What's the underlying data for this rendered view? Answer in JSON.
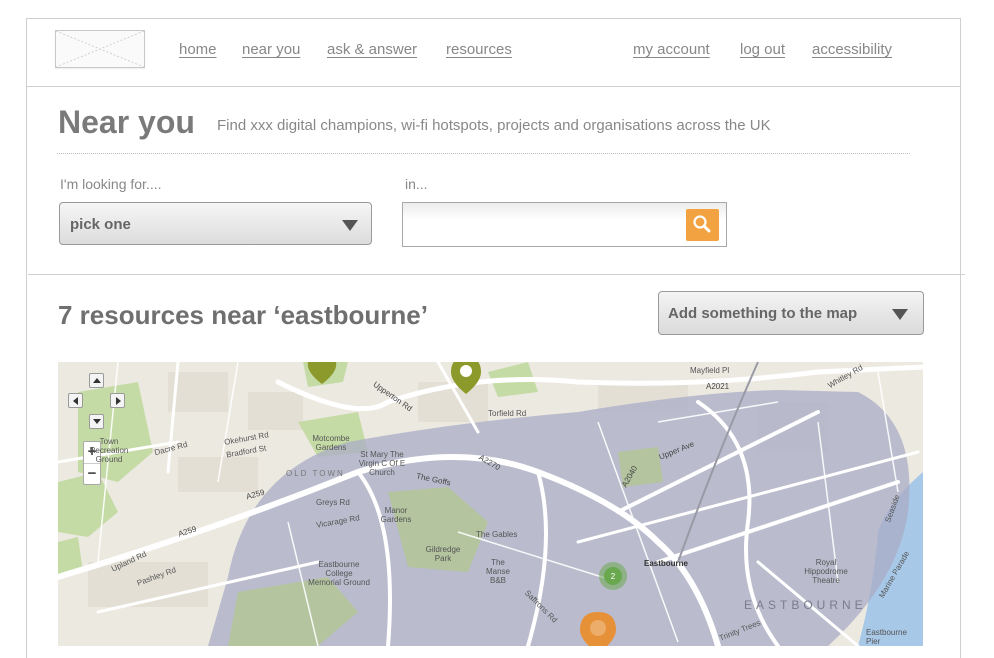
{
  "nav": {
    "left": [
      "home",
      "near you",
      "ask & answer",
      "resources"
    ],
    "right": [
      "my account",
      "log out",
      "accessibility"
    ]
  },
  "page": {
    "title": "Near you",
    "subtitle": "Find xxx digital champions, wi-fi hotspots, projects and organisations across the UK"
  },
  "filter": {
    "looking_label": "I'm looking for....",
    "select_value": "pick one",
    "in_label": "in...",
    "search_value": "",
    "search_placeholder": ""
  },
  "results": {
    "heading": "7 resources near ‘eastbourne’",
    "add_button": "Add something to the map"
  },
  "map": {
    "area_color": "#a9acc6",
    "marker_colors": {
      "olive": "#8c9a2b",
      "green": "#6aa84f",
      "orange": "#e69138"
    },
    "cluster_count": "2",
    "labels": {
      "eastbourne_big": "EASTBOURNE",
      "old_town": "OLD TOWN",
      "motcombe": "Motcombe Gardens",
      "manor": "Manor Gardens",
      "gildredge": "Gildredge Park",
      "station": "Eastbourne",
      "college": "Eastbourne College Memorial Ground",
      "royal": "Royal Hippodrome Theatre",
      "pier": "Eastbourne Pier",
      "the_gables": "The Gables",
      "the_manse": "The Manse B&B",
      "st_mary": "St Mary The Virgin C Of E Church",
      "the_goffs": "The Goffs",
      "upper_ave": "Upper Ave",
      "upperton_rd": "Upperton Rd",
      "a2021": "A2021",
      "a259a": "A259",
      "a259b": "A259",
      "a2270": "A2270",
      "a2040": "A2040",
      "mayfield": "Mayfield Pl",
      "torfield": "Torfield Rd",
      "pashley": "Pashley Rd",
      "upland": "Upland Rd",
      "greys": "Greys Rd",
      "vicarage": "Vicarage Rd",
      "saffrons": "Saffrons Rd",
      "whitley": "Whitley Rd",
      "seaside": "Seaside",
      "marine": "Marine Parade",
      "trinity": "Trinity Trees",
      "town_ground": "Town Recreation Ground",
      "bradford": "Bradford St",
      "okehurst": "Okehurst Rd",
      "dacre": "Dacre Rd"
    }
  }
}
